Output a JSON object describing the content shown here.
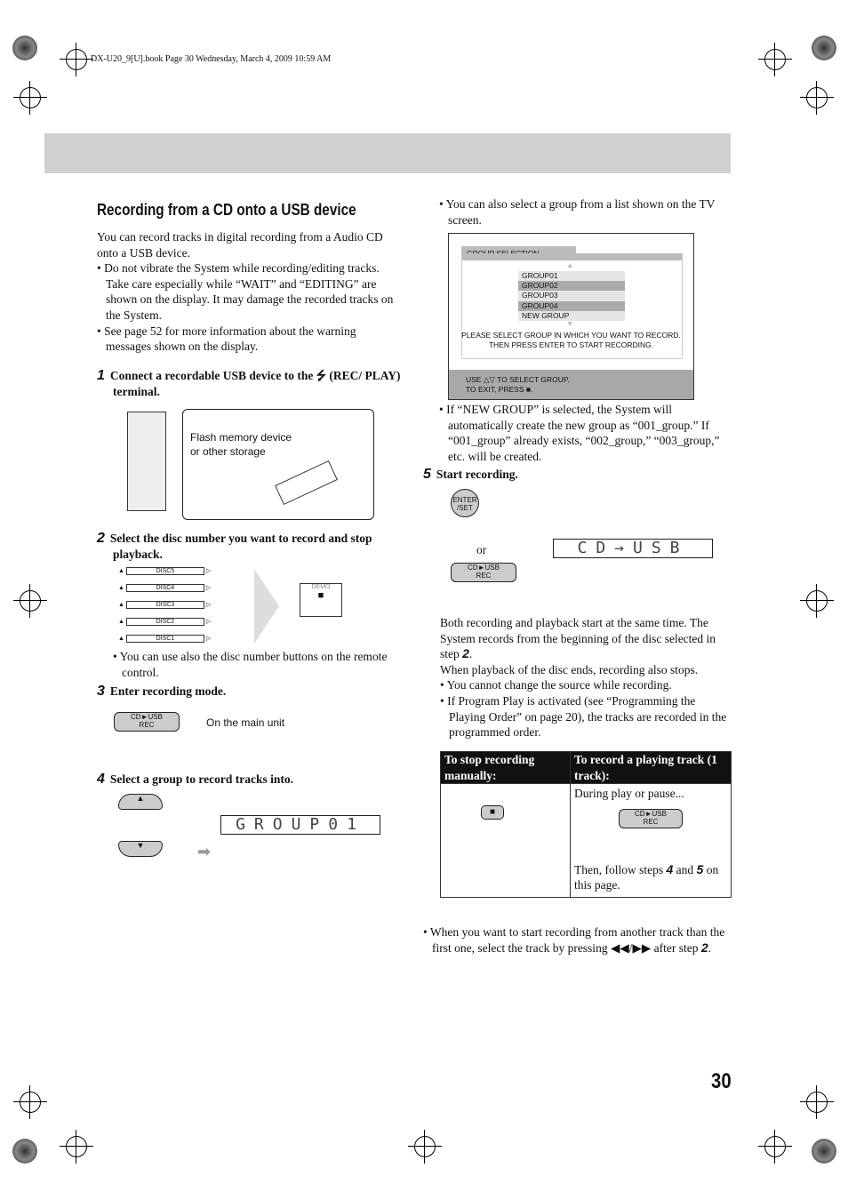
{
  "header": {
    "file_info": "DX-U20_9[U].book  Page 30  Wednesday, March 4, 2009  10:59 AM"
  },
  "section": {
    "title": "Recording from a CD onto a USB device"
  },
  "left": {
    "intro": "You can record tracks in digital recording from a Audio CD onto a USB device.",
    "bullets": [
      "• Do not vibrate the System while recording/editing tracks. Take care especially while “WAIT” and “EDITING” are shown on the display. It may damage the recorded tracks on the System.",
      "• See page 52 for more information about the warning messages shown on the display."
    ],
    "step1": {
      "num": "1",
      "text": "Connect a recordable USB device to the",
      "text2": "(REC/ PLAY) terminal."
    },
    "callout": {
      "line1": "Flash memory device",
      "line2": "or other storage"
    },
    "step2": {
      "num": "2",
      "text": "Select the disc number you want to record and stop playback."
    },
    "discs": [
      "DISC5",
      "DISC4",
      "DISC3",
      "DISC2",
      "DISC1"
    ],
    "demo_label": "DEMO",
    "step2_note": "• You can use also the disc number buttons on the remote control.",
    "step3": {
      "num": "3",
      "text": "Enter recording mode."
    },
    "cd_usb_button": {
      "line1": "CD►USB",
      "line2": "REC"
    },
    "main_unit_label": "On the main unit",
    "step4": {
      "num": "4",
      "text": "Select a group to record tracks into."
    },
    "display_group": "GROUP01"
  },
  "right": {
    "tv_note": "• You can also select a group from a list shown on the TV screen.",
    "tv": {
      "title": "GROUP SELECTION",
      "groups": [
        "GROUP01",
        "GROUP02",
        "GROUP03",
        "GROUP04",
        "NEW GROUP"
      ],
      "msg1": "PLEASE SELECT GROUP IN WHICH YOU WANT TO RECORD.",
      "msg2": "THEN PRESS ENTER TO START RECORDING.",
      "foot1": "USE △▽ TO SELECT GROUP.",
      "foot2": "TO EXIT, PRESS ■."
    },
    "new_group_note": "• If “NEW GROUP” is selected, the System will automatically create the new group as “001_group.” If “001_group” already exists, “002_group,” “003_group,” etc. will be created.",
    "step5": {
      "num": "5",
      "text": "Start recording."
    },
    "enter_button": "ENTER /SET",
    "or": "or",
    "display_cd_usb": "CD→USB",
    "para1": "Both recording and playback start at the same time. The System records from the beginning of the disc selected in step",
    "para1_ref": "2",
    "para2": "When playback of the disc ends, recording also stops.",
    "bullets": [
      "• You cannot change the source while recording.",
      "• If Program Play is activated (see “Programming the Playing Order” on page 20), the tracks are recorded in the programmed order."
    ],
    "table": {
      "h1": "To stop recording manually:",
      "h2": "To record a playing track (1 track):",
      "during": "During play or pause...",
      "then": "Then, follow steps",
      "s4": "4",
      "and": "and",
      "s5": "5",
      "on": "on this page."
    },
    "last_note": "• When you want to start recording from another track than the first one, select the track by pressing ◀◀/▶▶ after step",
    "last_ref": "2"
  },
  "page_number": "30",
  "colors": {
    "banner": "#d0d0d0",
    "table_header": "#111111",
    "tv_bar": "#a8a8a8"
  }
}
